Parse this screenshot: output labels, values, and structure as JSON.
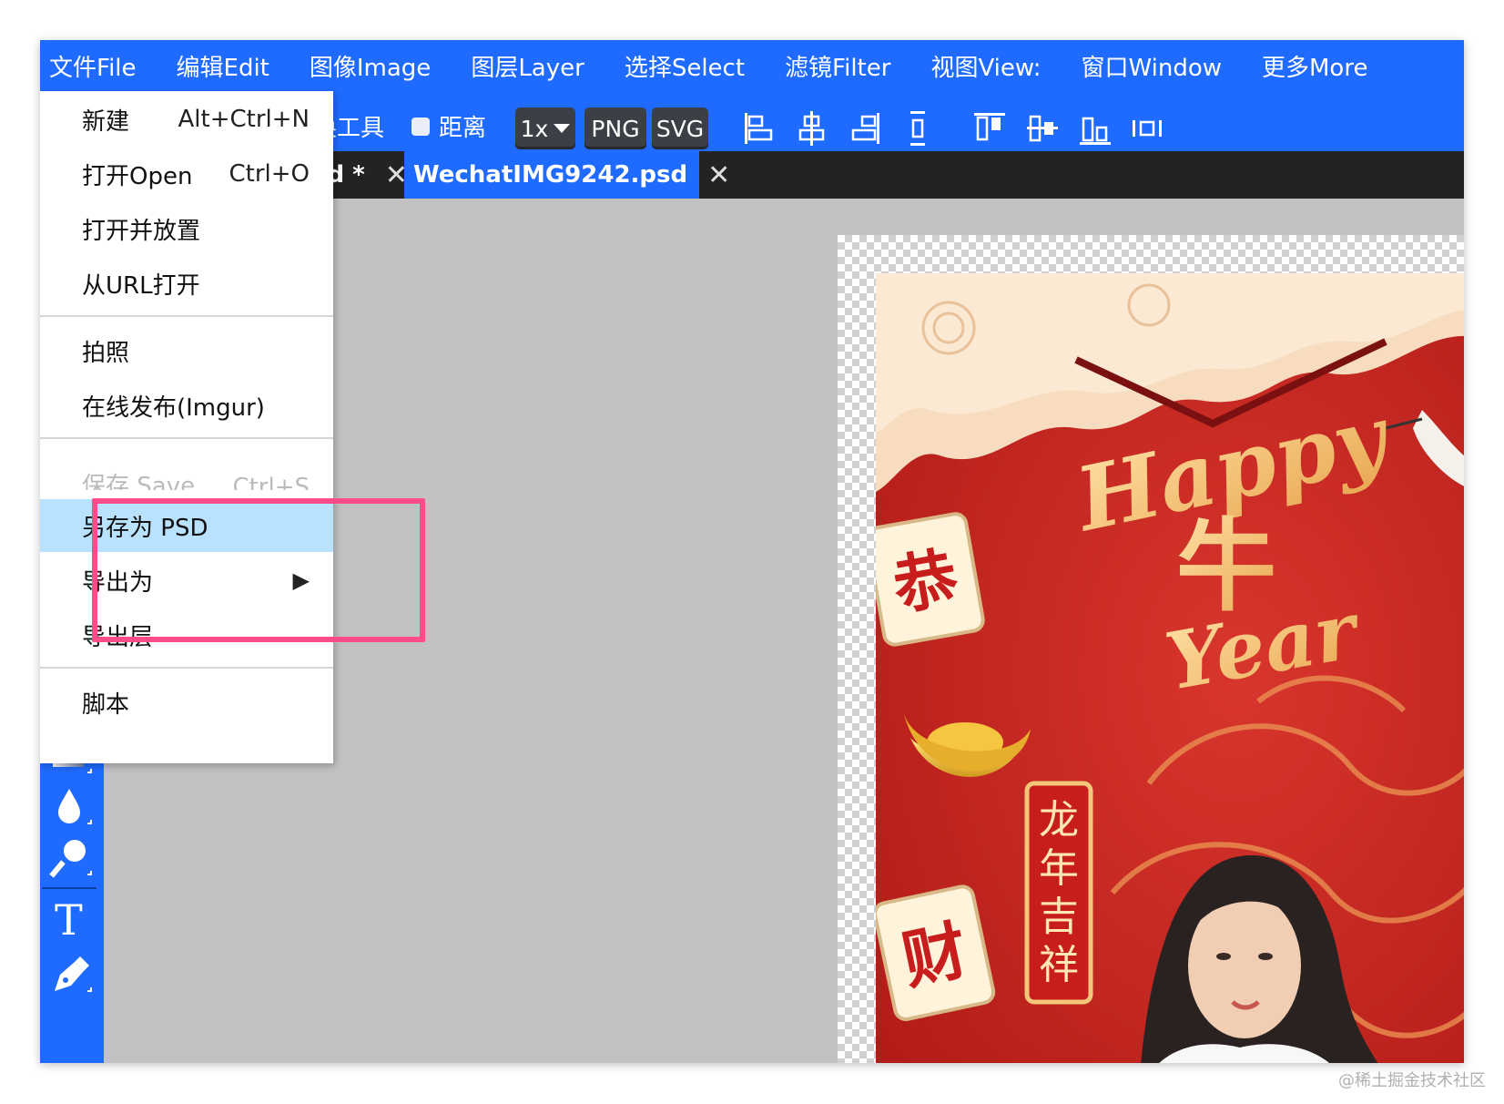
{
  "menubar": {
    "items": [
      "文件File",
      "编辑Edit",
      "图像Image",
      "图层Layer",
      "选择Select",
      "滤镜Filter",
      "视图View:",
      "窗口Window",
      "更多More"
    ]
  },
  "toolbar": {
    "transform_label": "换工具",
    "distance_label": "距离",
    "zoom_value": "1x",
    "png_label": "PNG",
    "svg_label": "SVG"
  },
  "tabs": [
    {
      "label": "sd *",
      "close": "✕",
      "active": false
    },
    {
      "label": "WechatIMG9242.psd",
      "close": "✕",
      "active": true
    }
  ],
  "file_menu": {
    "items": [
      {
        "label": "新建",
        "shortcut": "Alt+Ctrl+N"
      },
      {
        "label": "打开Open",
        "shortcut": "Ctrl+O"
      },
      {
        "label": "打开并放置",
        "shortcut": ""
      },
      {
        "label": "从URL打开",
        "shortcut": ""
      },
      {
        "label": "拍照",
        "shortcut": ""
      },
      {
        "label": "在线发布(Imgur)",
        "shortcut": ""
      },
      {
        "label": "保存 Save",
        "shortcut": "Ctrl+S"
      },
      {
        "label": "另存为 PSD",
        "shortcut": ""
      },
      {
        "label": "导出为",
        "shortcut": "▶"
      },
      {
        "label": "导出层",
        "shortcut": ""
      },
      {
        "label": "脚本",
        "shortcut": ""
      }
    ]
  },
  "poster": {
    "happy_text": "Happy",
    "year_text": "Year",
    "niu_char": "牛",
    "tile_top": "恭",
    "tile_bottom": "财",
    "scroll_text": [
      "龙",
      "年",
      "吉",
      "祥"
    ]
  },
  "watermark": "@稀土掘金技术社区",
  "colors": {
    "accent": "#1f6bff",
    "highlight": "#b9e2ff",
    "annotation": "#ff4d8a",
    "poster_red": "#c8231f"
  }
}
